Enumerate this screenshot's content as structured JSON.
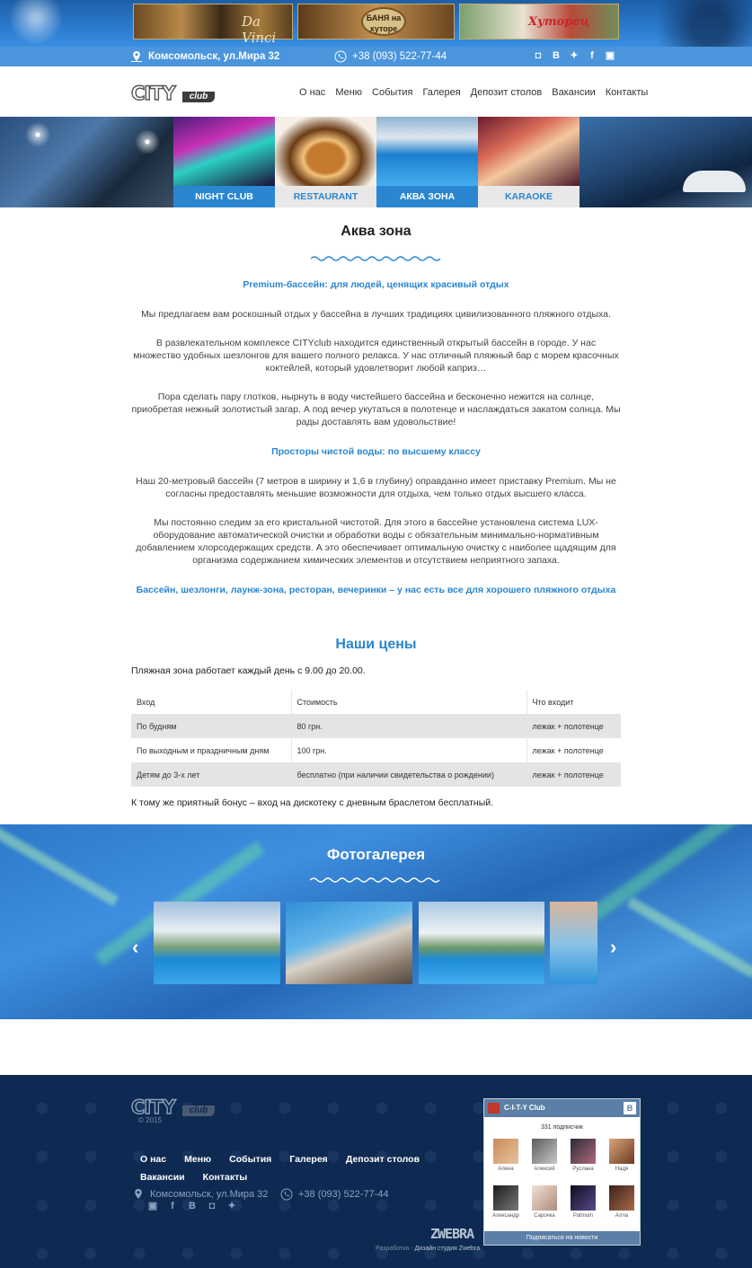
{
  "contacts": {
    "address": "Комсомольск, ул.Мира 32",
    "phone": "+38 (093) 522-77-44"
  },
  "ads": {
    "ad1_text": "Da Vinci",
    "ad2_text": "БАНЯ на хуторе",
    "ad3_text": "Хуторец"
  },
  "nav": [
    "О нас",
    "Меню",
    "События",
    "Галерея",
    "Депозит столов",
    "Вакансии",
    "Контакты"
  ],
  "logo": {
    "city": "CITY",
    "club": "club"
  },
  "tabs": [
    "NIGHT CLUB",
    "RESTAURANT",
    "АКВА ЗОНА",
    "KARAOKE"
  ],
  "page": {
    "title": "Аква зона",
    "sub1": "Premium-бассейн: для людей, ценящих красивый отдых",
    "p1": "Мы предлагаем вам роскошный отдых у бассейна в лучших традициях цивилизованного пляжного отдыха.",
    "p2": "В развлекательном комплексе CITYclub находится единственный открытый бассейн в городе. У нас множество удобных шезлонгов для вашего полного релакса. У нас отличный пляжный бар с морем красочных коктейлей, который удовлетворит любой каприз…",
    "p3": "Пора сделать пару глотков, нырнуть в воду чистейшего бассейна и бесконечно нежится на солнце, приобретая нежный золотистый загар. А под вечер укутаться в полотенце и наслаждаться закатом солнца. Мы рады доставлять вам удовольствие!",
    "sub2": "Просторы чистой воды: по высшему классу",
    "p4": "Наш 20-метровый бассейн (7 метров в ширину и 1,6 в глубину) оправданно имеет приставку Premium. Мы не согласны предоставлять меньшие возможности для отдыха, чем только отдых высшего класса.",
    "p5": "Мы постоянно следим за его кристальной чистотой. Для этого в бассейне установлена система LUX-оборудование автоматической очистки и обработки воды с обязательным минимально-нормативным добавлением хлорсодержащих средств. А это обеспечивает оптимальную очистку с наиболее щадящим для организма содержанием химических элементов и отсутствием неприятного запаха.",
    "sub3": "Бассейн, шезлонги, лаунж-зона, ресторан, вечеринки – у нас есть все для хорошего пляжного отдыха"
  },
  "prices": {
    "title": "Наши цены",
    "hours": "Пляжная зона работает каждый день с 9.00 до 20.00.",
    "headers": [
      "Вход",
      "Стоимость",
      "Что входит"
    ],
    "rows": [
      [
        "По будням",
        "80 грн.",
        "лежак + полотенце"
      ],
      [
        "По выходным и праздничным дням",
        "100 грн.",
        "лежак + полотенце"
      ],
      [
        "Детям до 3-х лет",
        "бесплатно (при наличии свидетельства о рождении)",
        "лежак + полотенце"
      ]
    ],
    "bonus": "К тому же приятный бонус – вход на дискотеку с дневным браслетом бесплатный."
  },
  "gallery": {
    "title": "Фотогалерея"
  },
  "footer": {
    "copyright": "© 2015",
    "nav": [
      "О нас",
      "Меню",
      "События",
      "Галерея",
      "Депозит столов",
      "Вакансии",
      "Контакты"
    ],
    "studio_logo": "ZWEBRA",
    "dev_prefix": "Разработка - ",
    "dev_name": "Дизайн студия Zwebra"
  },
  "vk": {
    "name": "C-I-T-Y Club",
    "button": "В",
    "count": "331 подписчик",
    "users": [
      "Алена",
      "Алексей",
      "Руслана",
      "Надя",
      "Александр",
      "Сарочка",
      "Patmum",
      "Алла"
    ],
    "subscribe": "Подписаться на новости"
  },
  "colors": {
    "accent": "#2a86d0",
    "info_bar": "#4a95dc",
    "footer": "#0e2a52",
    "vk": "#5b7fa6"
  }
}
